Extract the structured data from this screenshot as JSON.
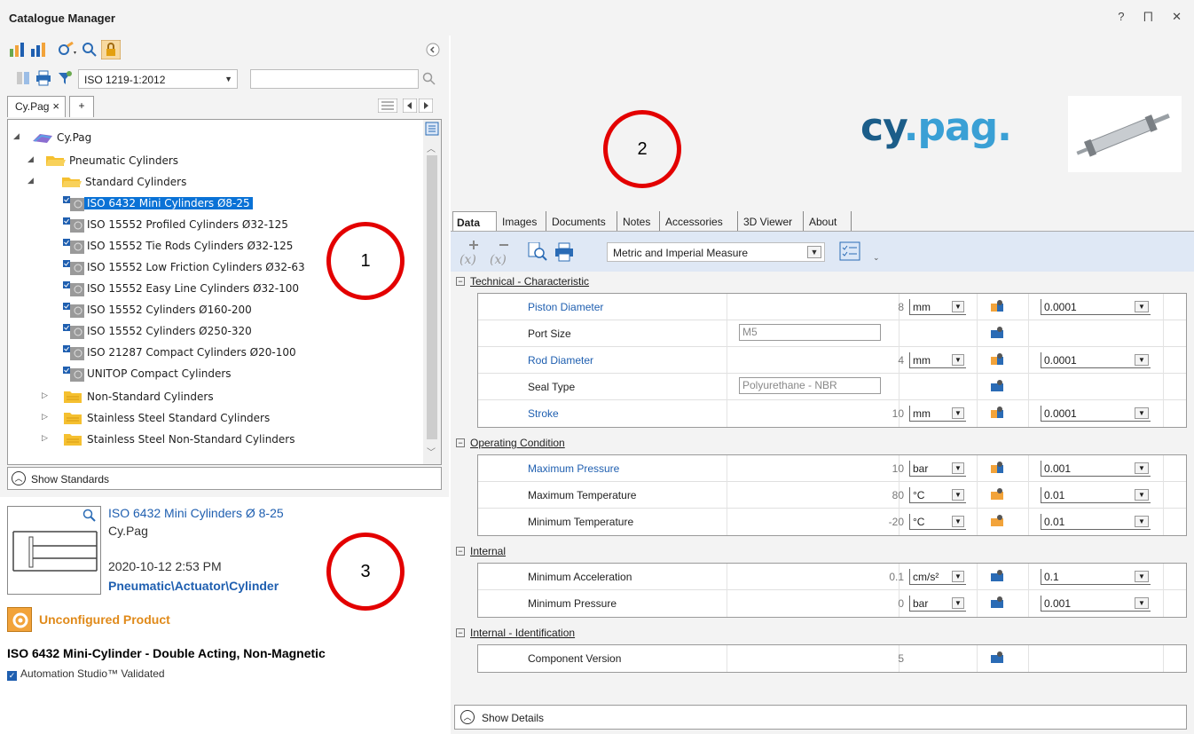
{
  "window": {
    "title": "Catalogue Manager",
    "ctrl_help": "?",
    "ctrl_pin": "⨅",
    "ctrl_close": "✕"
  },
  "toolbar": {
    "standard_combo": "ISO 1219-1:2012",
    "search_value": ""
  },
  "tabs": {
    "left_tab": "Cy.Pag",
    "left_tab_close": "×",
    "add_tab": "+"
  },
  "tree": {
    "root": "Cy.Pag",
    "nodes": [
      {
        "label": "Pneumatic Cylinders"
      },
      {
        "label": "Standard Cylinders"
      },
      {
        "label": "ISO 6432 Mini Cylinders Ø8-25"
      },
      {
        "label": "ISO 15552 Profiled Cylinders Ø32-125"
      },
      {
        "label": "ISO 15552 Tie Rods Cylinders Ø32-125"
      },
      {
        "label": "ISO 15552 Low Friction Cylinders Ø32-63"
      },
      {
        "label": "ISO 15552 Easy Line Cylinders Ø32-100"
      },
      {
        "label": "ISO 15552 Cylinders Ø160-200"
      },
      {
        "label": "ISO 15552 Cylinders Ø250-320"
      },
      {
        "label": "ISO 21287 Compact Cylinders Ø20-100"
      },
      {
        "label": "UNITOP Compact Cylinders"
      },
      {
        "label": "Non-Standard Cylinders"
      },
      {
        "label": "Stainless Steel Standard Cylinders"
      },
      {
        "label": "Stainless Steel Non-Standard Cylinders"
      }
    ]
  },
  "show_standards": "Show Standards",
  "info": {
    "name": "ISO 6432 Mini Cylinders Ø 8-25",
    "brand": "Cy.Pag",
    "date": "2020-10-12 2:53 PM",
    "path": "Pneumatic\\Actuator\\Cylinder",
    "status": "Unconfigured Product",
    "description": "ISO 6432 Mini-Cylinder - Double Acting, Non-Magnetic",
    "validated": "Automation Studio™ Validated"
  },
  "logo": {
    "part1": "cy",
    "part2": ".pag."
  },
  "right_tabs": [
    "Data",
    "Images",
    "Documents",
    "Notes",
    "Accessories",
    "3D Viewer",
    "About"
  ],
  "measure_combo": "Metric and Imperial Measure",
  "categories": [
    {
      "title": "Technical - Characteristic"
    },
    {
      "title": "Operating Condition"
    },
    {
      "title": "Internal"
    },
    {
      "title": "Internal - Identification"
    }
  ],
  "params": [
    {
      "name": "Piston Diameter",
      "value": "8",
      "unit": "mm",
      "precision": "0.0001"
    },
    {
      "name": "Port Size",
      "text": "M5"
    },
    {
      "name": "Rod Diameter",
      "value": "4",
      "unit": "mm",
      "precision": "0.0001"
    },
    {
      "name": "Seal Type",
      "text": "Polyurethane - NBR"
    },
    {
      "name": "Stroke",
      "value": "10",
      "unit": "mm",
      "precision": "0.0001"
    },
    {
      "name": "Maximum Pressure",
      "value": "10",
      "unit": "bar",
      "precision": "0.001"
    },
    {
      "name": "Maximum Temperature",
      "value": "80",
      "unit": "°C",
      "precision": "0.01"
    },
    {
      "name": "Minimum Temperature",
      "value": "-20",
      "unit": "°C",
      "precision": "0.01"
    },
    {
      "name": "Minimum Acceleration",
      "value": "0.1",
      "unit": "cm/s²",
      "precision": "0.1"
    },
    {
      "name": "Minimum Pressure",
      "value": "0",
      "unit": "bar",
      "precision": "0.001"
    },
    {
      "name": "Component Version",
      "value": "5"
    }
  ],
  "show_details": "Show Details",
  "annotations": [
    "1",
    "2",
    "3"
  ],
  "colors": {
    "accent": "#0a72d6",
    "annotation": "#e30000",
    "link": "#1f5fb0"
  }
}
